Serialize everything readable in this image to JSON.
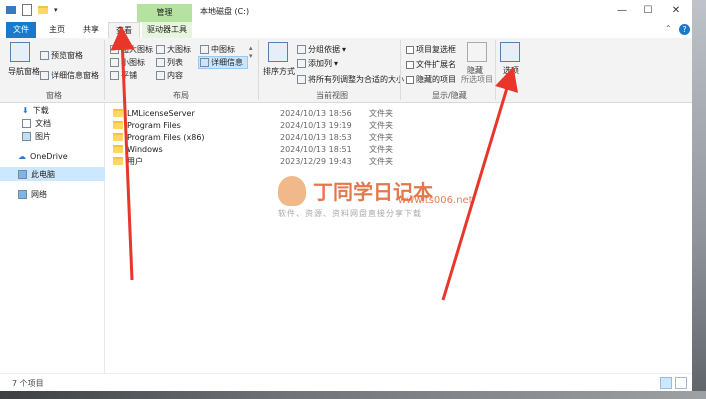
{
  "window": {
    "title": "本地磁盘 (C:)",
    "context_tab": "管理",
    "controls": {
      "minimize": "—",
      "maximize": "☐",
      "close": "✕"
    }
  },
  "tabs": {
    "file": "文件",
    "home": "主页",
    "share": "共享",
    "view": "查看",
    "drive_tools": "驱动器工具"
  },
  "ribbon": {
    "panes": {
      "nav_pane": "导航窗格",
      "preview_pane": "预览窗格",
      "details_pane": "详细信息窗格",
      "label": "窗格"
    },
    "layout": {
      "extra_large_icons": "超大图标",
      "large_icons": "大图标",
      "medium_icons": "中图标",
      "small_icons": "小图标",
      "list": "列表",
      "details": "详细信息",
      "tiles": "平铺",
      "content": "内容",
      "label": "布局"
    },
    "current_view": {
      "sort_by": "排序方式",
      "group_by": "分组依据",
      "add_columns": "添加列",
      "size_all_columns": "将所有列调整为合适的大小",
      "label": "当前视图"
    },
    "show_hide": {
      "item_checkboxes": "项目复选框",
      "file_extensions": "文件扩展名",
      "hidden_items": "隐藏的项目",
      "hide_selected": "隐藏",
      "hide_selected_sub": "所选项目",
      "label": "显示/隐藏"
    },
    "options": "选项"
  },
  "nav": {
    "items": [
      {
        "label": "下载",
        "pinned": true
      },
      {
        "label": "文档",
        "pinned": true
      },
      {
        "label": "图片",
        "pinned": true
      },
      {
        "label": "OneDrive"
      },
      {
        "label": "此电脑"
      },
      {
        "label": "网络"
      }
    ]
  },
  "files": [
    {
      "name": "LMLicenseServer",
      "date": "2024/10/13 18:56",
      "type": "文件夹"
    },
    {
      "name": "Program Files",
      "date": "2024/10/13 19:19",
      "type": "文件夹"
    },
    {
      "name": "Program Files (x86)",
      "date": "2024/10/13 18:53",
      "type": "文件夹"
    },
    {
      "name": "Windows",
      "date": "2024/10/13 18:51",
      "type": "文件夹"
    },
    {
      "name": "用户",
      "date": "2023/12/29 19:43",
      "type": "文件夹"
    }
  ],
  "status": {
    "item_count": "7 个项目"
  },
  "watermark": {
    "title": "丁同学日记本",
    "url": "www.ts006.net",
    "subtitle": "软件、资源、资料网盘直接分享下载"
  },
  "accent_colors": {
    "file_tab": "#1979ca",
    "context_tab": "#b6e2a1",
    "selection": "#cce8ff",
    "arrow": "#e8362a"
  }
}
